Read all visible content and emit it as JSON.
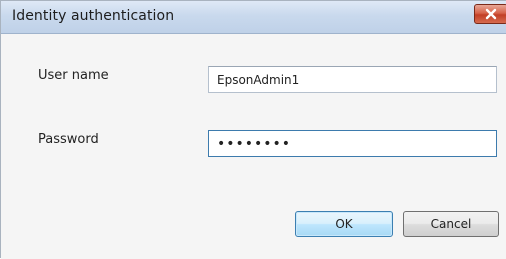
{
  "window": {
    "title": "Identity authentication",
    "close_icon": "close-icon"
  },
  "form": {
    "username_label": "User name",
    "username_value": "EpsonAdmin1",
    "password_label": "Password",
    "password_value": "••••••••"
  },
  "buttons": {
    "ok_label": "OK",
    "cancel_label": "Cancel"
  },
  "colors": {
    "close_button": "#c94a30",
    "default_button_border": "#3c7fb1",
    "focused_field_border": "#3d7bad"
  }
}
